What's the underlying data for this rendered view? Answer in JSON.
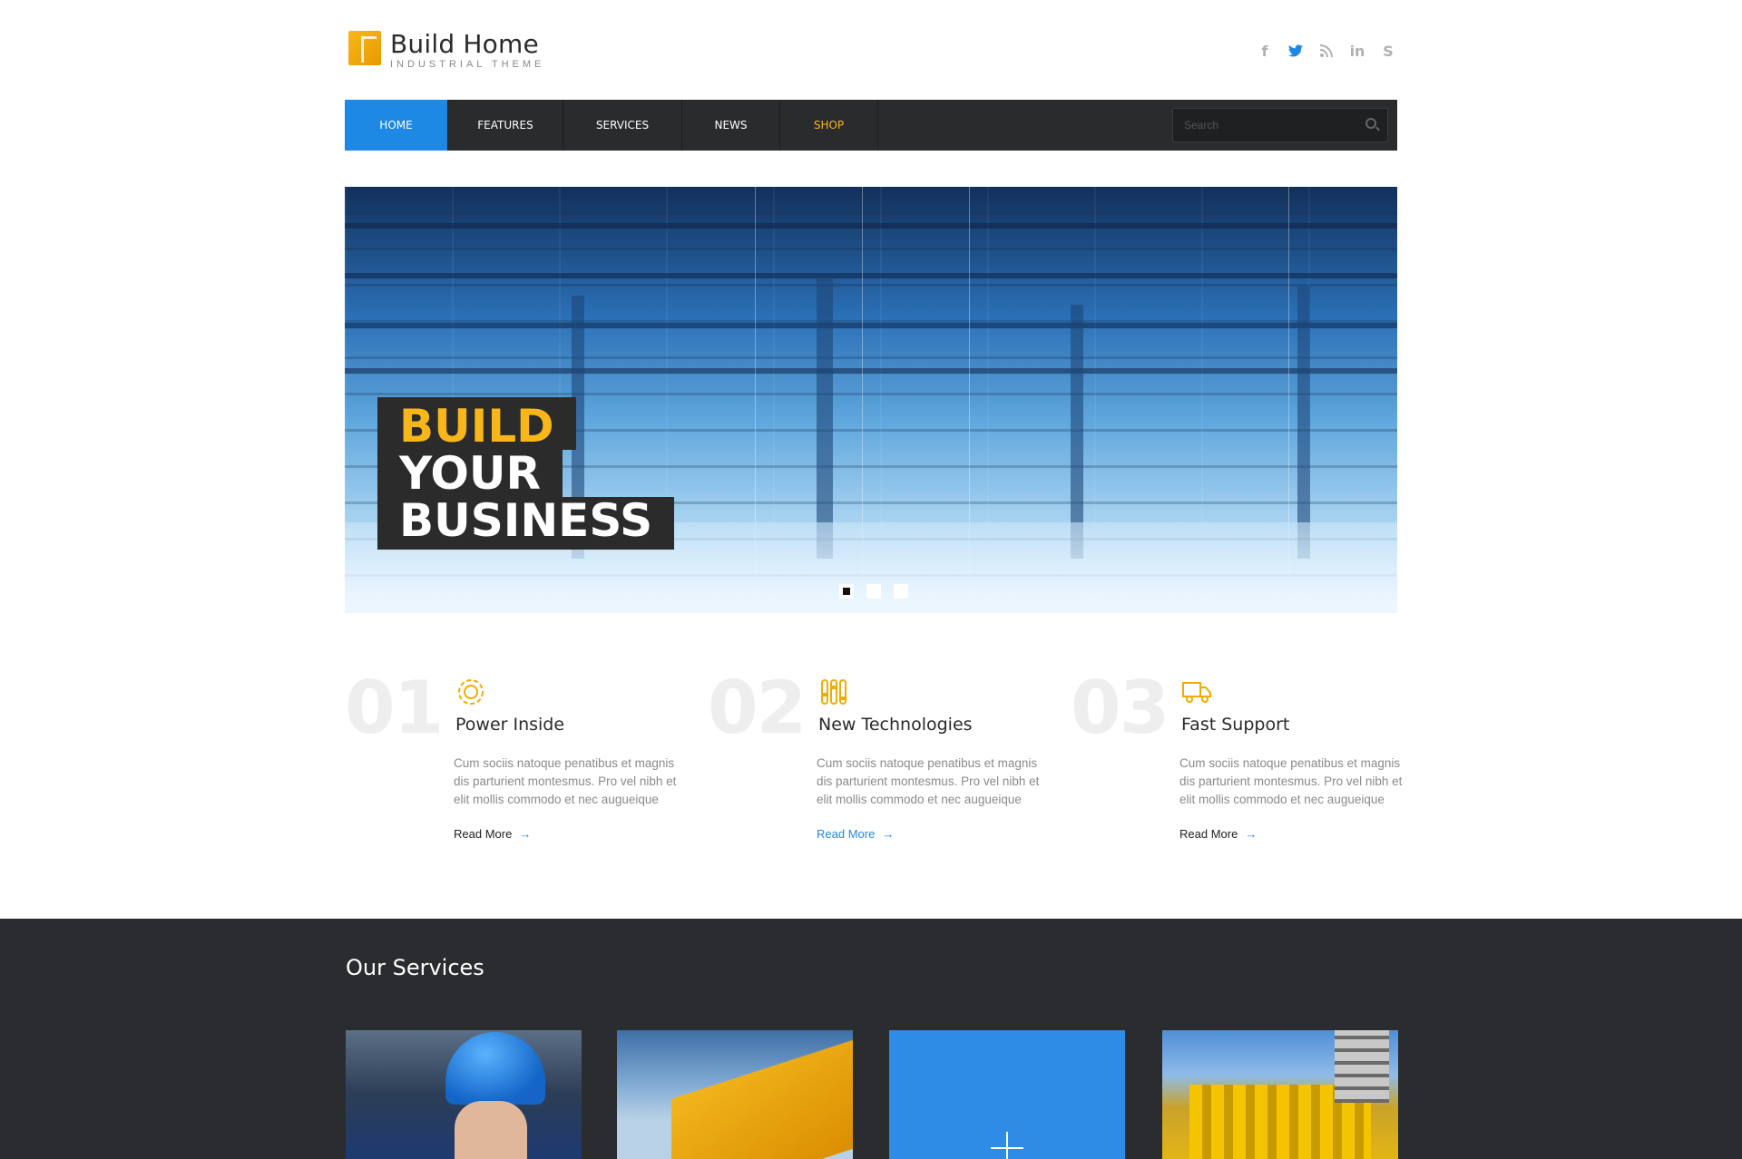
{
  "brand": {
    "name": "Build Home",
    "tagline": "INDUSTRIAL THEME"
  },
  "social": [
    {
      "name": "facebook-icon",
      "glyph": "f"
    },
    {
      "name": "twitter-icon",
      "glyph": "🐦"
    },
    {
      "name": "rss-icon",
      "glyph": "◠"
    },
    {
      "name": "linkedin-icon",
      "glyph": "in"
    },
    {
      "name": "skype-icon",
      "glyph": "S"
    }
  ],
  "nav": {
    "items": [
      {
        "label": "HOME"
      },
      {
        "label": "FEATURES"
      },
      {
        "label": "SERVICES"
      },
      {
        "label": "NEWS"
      },
      {
        "label": "SHOP"
      }
    ],
    "search_placeholder": "Search"
  },
  "hero": {
    "line1": "BUILD",
    "line2": "YOUR",
    "line3": "BUSINESS",
    "active_slide": 1,
    "slides": 3
  },
  "features": [
    {
      "num": "01",
      "icon": "gear-icon",
      "title": "Power Inside",
      "text": "Cum sociis natoque penatibus et magnis dis parturient montesmus. Pro vel nibh et elit mollis commodo et nec augueique",
      "link": "Read More"
    },
    {
      "num": "02",
      "icon": "sliders-icon",
      "title": "New Technologies",
      "text": "Cum sociis natoque penatibus et magnis dis parturient montesmus. Pro vel nibh et elit mollis commodo et nec augueique",
      "link": "Read More"
    },
    {
      "num": "03",
      "icon": "truck-icon",
      "title": "Fast Support",
      "text": "Cum sociis natoque penatibus et magnis dis parturient montesmus. Pro vel nibh et elit mollis commodo et nec augueique",
      "link": "Read More"
    }
  ],
  "services": {
    "title": "Our Services"
  },
  "colors": {
    "accent_blue": "#1e88e5",
    "accent_yellow": "#f7b71a",
    "dark": "#2a2b2d"
  }
}
